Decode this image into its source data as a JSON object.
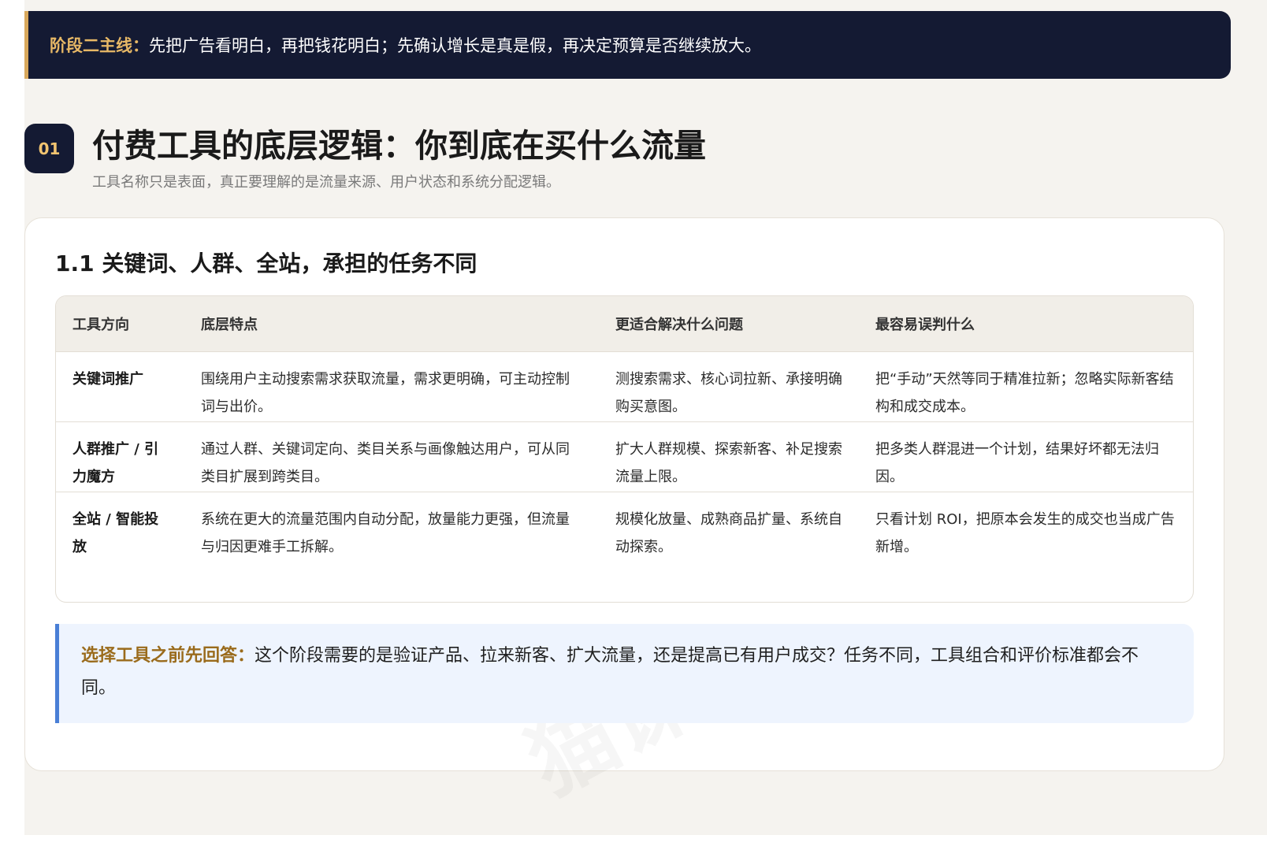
{
  "banner": {
    "lead": "阶段二主线：",
    "text": "先把广告看明白，再把钱花明白；先确认增长是真是假，再决定预算是否继续放大。"
  },
  "section": {
    "number": "01",
    "title": "付费工具的底层逻辑：你到底在买什么流量",
    "subtitle": "工具名称只是表面，真正要理解的是流量来源、用户状态和系统分配逻辑。"
  },
  "card": {
    "heading": "1.1 关键词、人群、全站，承担的任务不同",
    "table": {
      "headers": [
        "工具方向",
        "底层特点",
        "更适合解决什么问题",
        "最容易误判什么"
      ],
      "rows": [
        [
          "关键词推广",
          "围绕用户主动搜索需求获取流量，需求更明确，可主动控制词与出价。",
          "测搜索需求、核心词拉新、承接明确购买意图。",
          "把“手动”天然等同于精准拉新；忽略实际新客结构和成交成本。"
        ],
        [
          "人群推广 / 引力魔方",
          "通过人群、关键词定向、类目关系与画像触达用户，可从同类目扩展到跨类目。",
          "扩大人群规模、探索新客、补足搜索流量上限。",
          "把多类人群混进一个计划，结果好坏都无法归因。"
        ],
        [
          "全站 / 智能投放",
          "系统在更大的流量范围内自动分配，放量能力更强，但流量与归因更难手工拆解。",
          "规模化放量、成熟商品扩量、系统自动探索。",
          "只看计划 ROI，把原本会发生的成交也当成广告新增。"
        ]
      ]
    },
    "callout": {
      "lead": "选择工具之前先回答：",
      "text": "这个阶段需要的是验证产品、拉来新客、扩大流量，还是提高已有用户成交？任务不同，工具组合和评价标准都会不同。"
    },
    "watermark": "猫课"
  }
}
